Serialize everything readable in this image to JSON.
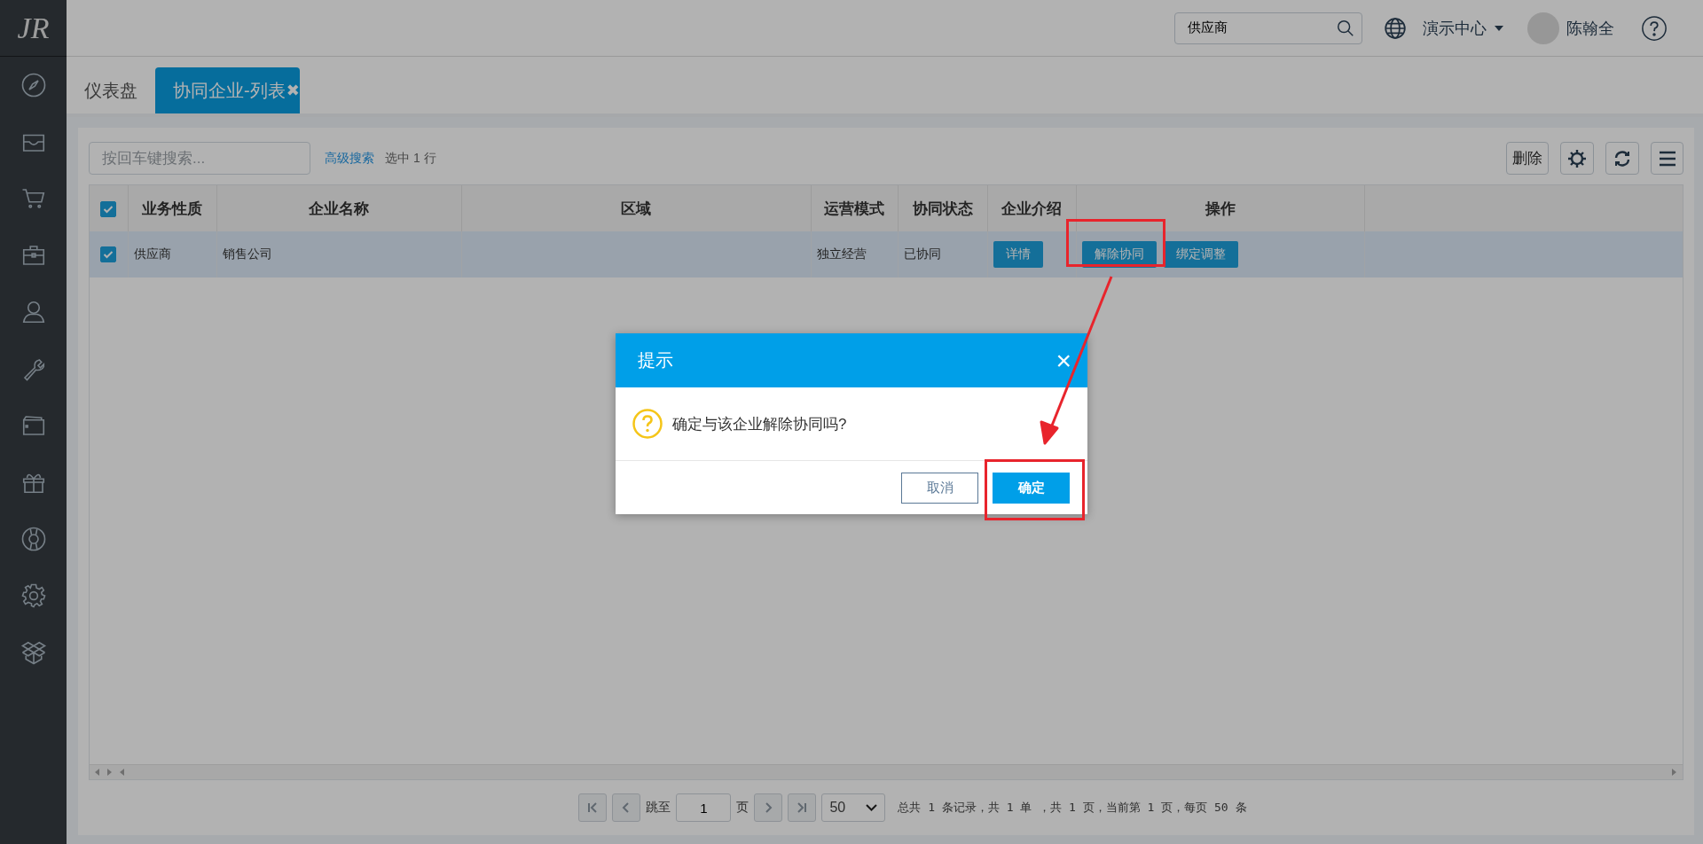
{
  "logo": "JR",
  "topbar": {
    "search": {
      "value": "供应商"
    },
    "org": "演示中心",
    "user": "陈翰全"
  },
  "tabs": [
    {
      "label": "仪表盘",
      "selected": false
    },
    {
      "label": "协同企业-列表",
      "selected": true,
      "close": "✖"
    }
  ],
  "toolbar": {
    "search": {
      "placeholder": "按回车键搜索..."
    },
    "advanced_link": "高级搜索",
    "selection": "选中 1 行",
    "delete_button": "删除"
  },
  "table": {
    "all_checked": true,
    "columns": [
      "业务性质",
      "企业名称",
      "区域",
      "运营模式",
      "协同状态",
      "企业介绍",
      "操作"
    ],
    "rows": [
      {
        "selected": true,
        "cells": [
          "供应商",
          "销售公司",
          "",
          "独立经营",
          "已协同"
        ],
        "intro_button": "详情",
        "actions": [
          "解除协同",
          "绑定调整"
        ]
      }
    ]
  },
  "pagination": {
    "jump_label": "跳至",
    "page": "1",
    "page_unit": "页",
    "page_size": "50",
    "summary": "总共 1 条记录，共 1 单 ，共 1 页，当前第 1 页，每页 50 条"
  },
  "dialog": {
    "title": "提示",
    "close": "×",
    "message": "确定与该企业解除协同吗?",
    "buttons": [
      {
        "label": "取消",
        "kind": "secondary"
      },
      {
        "label": "确定",
        "kind": "primary"
      }
    ]
  }
}
